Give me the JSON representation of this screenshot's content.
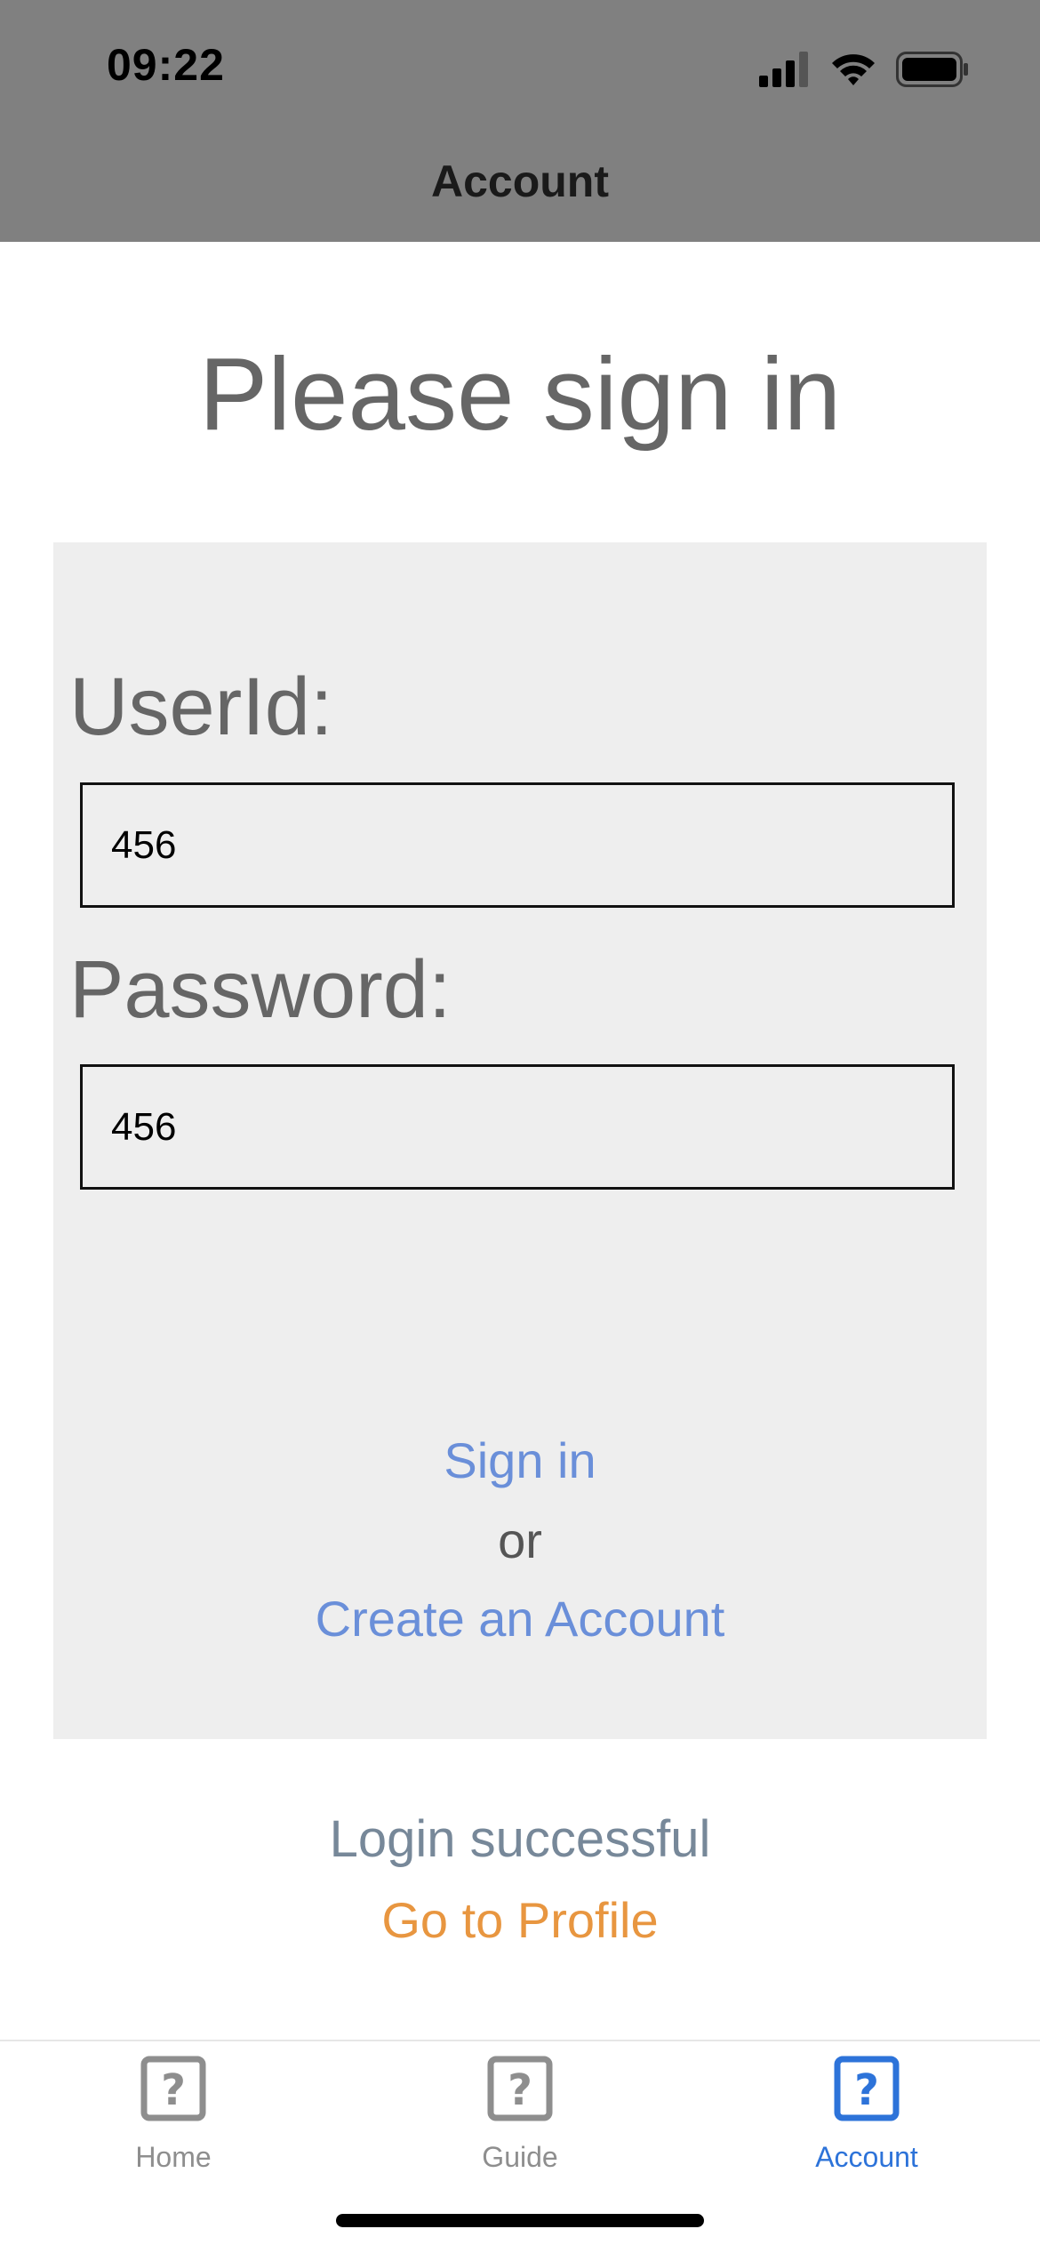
{
  "status_bar": {
    "time": "09:22"
  },
  "header": {
    "title": "Account"
  },
  "main": {
    "page_title": "Please sign in",
    "form": {
      "userid_label": "UserId:",
      "userid_value": "456",
      "password_label": "Password:",
      "password_value": "456",
      "signin_label": "Sign in",
      "or_text": "or",
      "create_account_label": "Create an Account"
    },
    "login_status": "Login successful",
    "profile_link": "Go to Profile"
  },
  "tabs": [
    {
      "label": "Home",
      "icon": "question-icon",
      "active": false
    },
    {
      "label": "Guide",
      "icon": "question-icon",
      "active": false
    },
    {
      "label": "Account",
      "icon": "question-icon",
      "active": true
    }
  ],
  "colors": {
    "header_bg": "#808080",
    "link": "#6a8fd9",
    "profile_link": "#e89640",
    "status_text": "#778899",
    "tab_active": "#2d73d9",
    "tab_inactive": "#8e8e8e",
    "card_bg": "#eeeeee"
  }
}
